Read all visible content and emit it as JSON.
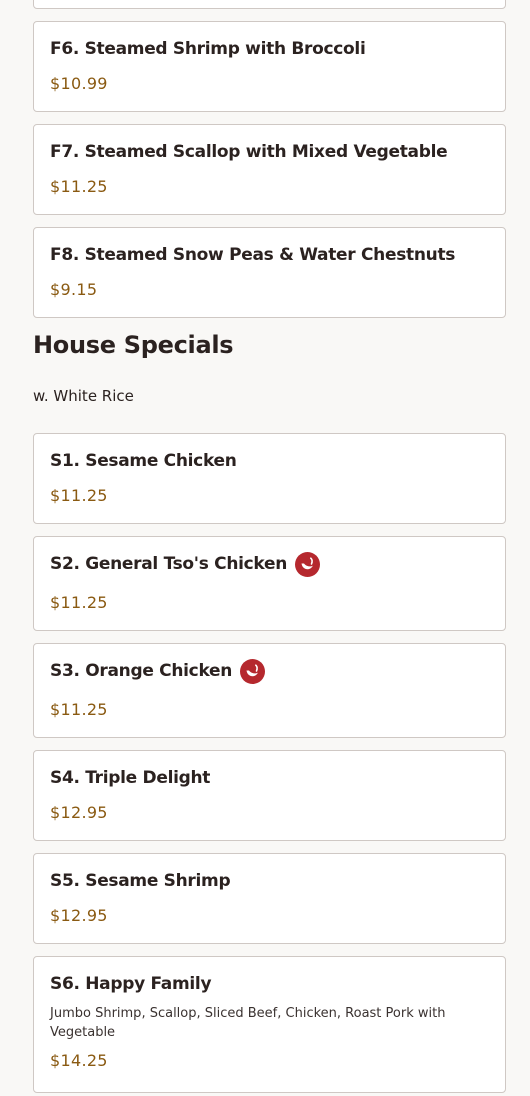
{
  "steamed_items": [
    {
      "title": "F6. Steamed Shrimp with Broccoli",
      "price": "$10.99"
    },
    {
      "title": "F7. Steamed Scallop with Mixed Vegetable",
      "price": "$11.25"
    },
    {
      "title": "F8. Steamed Snow Peas & Water Chestnuts",
      "price": "$9.15"
    }
  ],
  "house_specials": {
    "heading": "House Specials",
    "subtitle": "w. White Rice",
    "items": [
      {
        "title": "S1. Sesame Chicken",
        "price": "$11.25",
        "spicy": false
      },
      {
        "title": "S2. General Tso's Chicken",
        "price": "$11.25",
        "spicy": true
      },
      {
        "title": "S3. Orange Chicken",
        "price": "$11.25",
        "spicy": true
      },
      {
        "title": "S4. Triple Delight",
        "price": "$12.95",
        "spicy": false
      },
      {
        "title": "S5. Sesame Shrimp",
        "price": "$12.95",
        "spicy": false
      },
      {
        "title": "S6. Happy Family",
        "description": "Jumbo Shrimp, Scallop, Sliced Beef, Chicken, Roast Pork with Vegetable",
        "price": "$14.25",
        "spicy": false
      }
    ]
  },
  "colors": {
    "price": "#8a5a12",
    "spicy_icon": "#b5282e",
    "card_border": "#cfc8c4",
    "background": "#f9f8f6"
  },
  "icons": {
    "spicy": "chili-pepper-icon"
  }
}
